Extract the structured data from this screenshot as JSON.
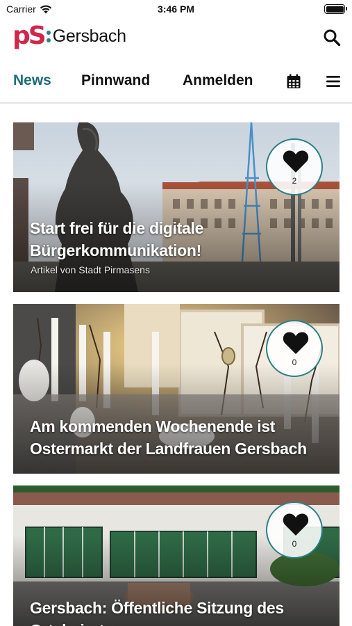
{
  "status_bar": {
    "carrier": "Carrier",
    "time": "3:46 PM",
    "battery_level": 1.0
  },
  "header": {
    "logo_letters": "pS",
    "logo_name": "Gersbach",
    "search_icon": "search-icon",
    "colors": {
      "brand_red": "#d1264a",
      "brand_teal": "#2b7f86",
      "accent": "#1f6d76"
    }
  },
  "tabs": [
    {
      "label": "News",
      "active": true
    },
    {
      "label": "Pinnwand",
      "active": false
    },
    {
      "label": "Anmelden",
      "active": false
    }
  ],
  "tab_icons": [
    "calendar-icon",
    "menu-icon"
  ],
  "articles": [
    {
      "title": "Start frei für die digitale Bürgerkommunikation!",
      "subtitle": "Artikel von Stadt Pirmasens",
      "likes": "2"
    },
    {
      "title": "Am kommenden Wochenende ist Ostermarkt der Landfrauen Gersbach",
      "subtitle": "",
      "likes": "0"
    },
    {
      "title": "Gersbach: Öffentliche Sitzung des Ortsbeirates",
      "subtitle": "",
      "likes": "0"
    }
  ]
}
